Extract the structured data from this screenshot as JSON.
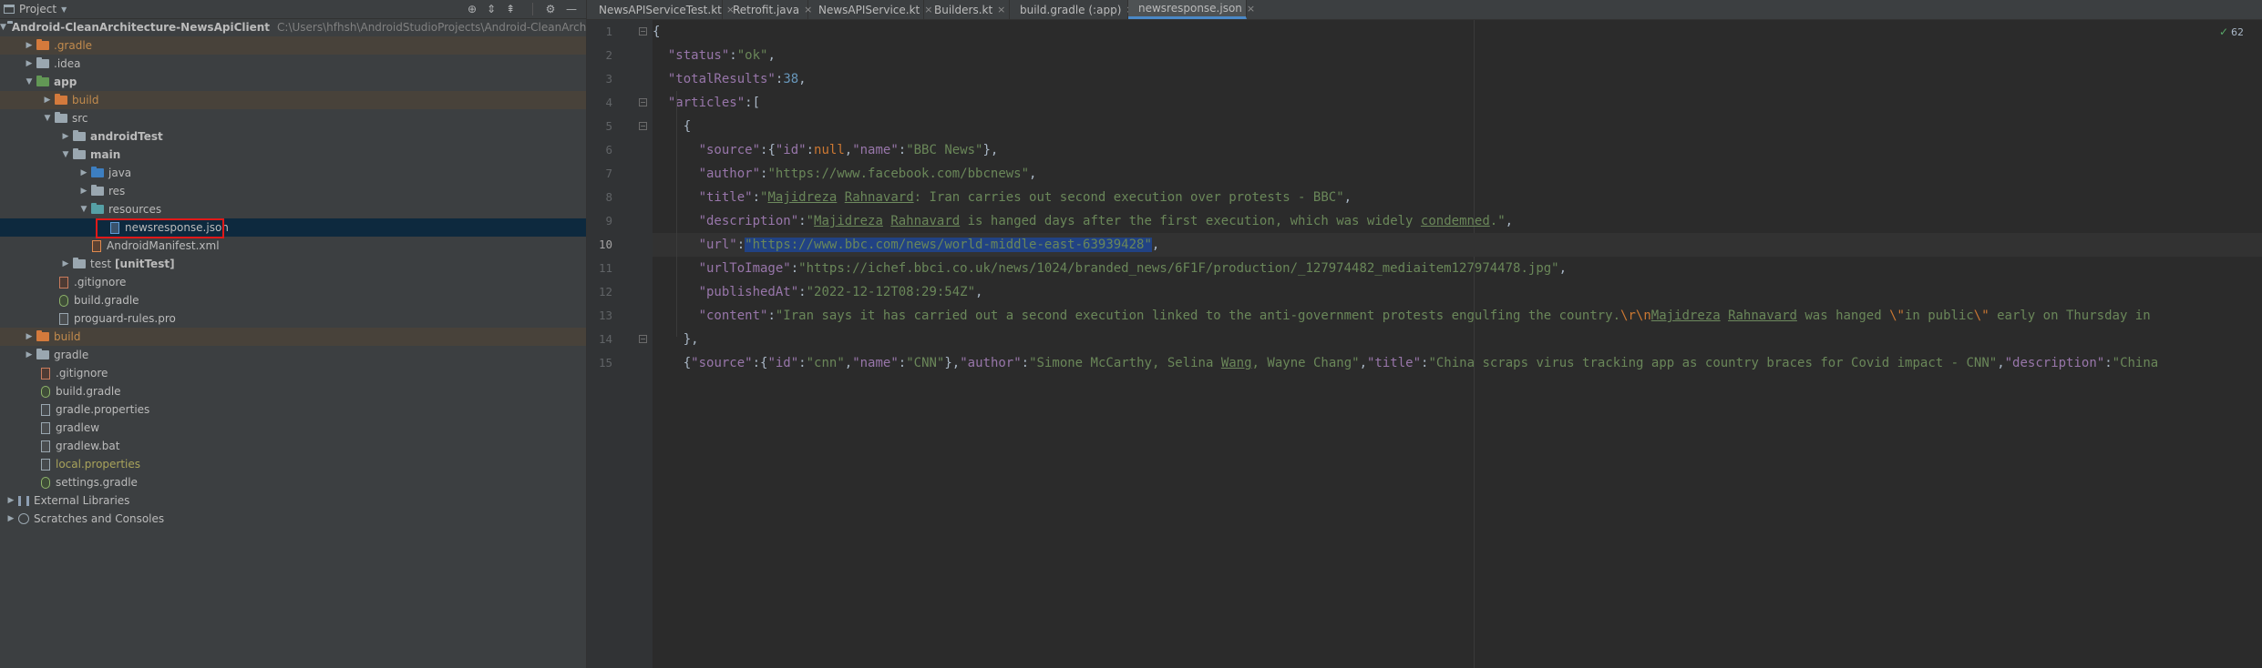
{
  "project_panel": {
    "title": "Project",
    "tools": {
      "locate": "⊕",
      "expand": "⇕",
      "collapse": "⇞",
      "settings": "⚙",
      "hide": "—"
    },
    "tree": [
      {
        "label": "Android-CleanArchitecture-NewsApiClient",
        "path": "C:\\Users\\hfhsh\\AndroidStudioProjects\\Android-CleanArchitec"
      },
      {
        "label": ".gradle"
      },
      {
        "label": ".idea"
      },
      {
        "label": "app"
      },
      {
        "label": "build"
      },
      {
        "label": "src"
      },
      {
        "label": "androidTest"
      },
      {
        "label": "main"
      },
      {
        "label": "java"
      },
      {
        "label": "res"
      },
      {
        "label": "resources"
      },
      {
        "label": "newsresponse.json"
      },
      {
        "label": "AndroidManifest.xml"
      },
      {
        "label": "test",
        "suffix": "[unitTest]"
      },
      {
        "label": ".gitignore"
      },
      {
        "label": "build.gradle"
      },
      {
        "label": "proguard-rules.pro"
      },
      {
        "label": "build"
      },
      {
        "label": "gradle"
      },
      {
        "label": ".gitignore"
      },
      {
        "label": "build.gradle"
      },
      {
        "label": "gradle.properties"
      },
      {
        "label": "gradlew"
      },
      {
        "label": "gradlew.bat"
      },
      {
        "label": "local.properties"
      },
      {
        "label": "settings.gradle"
      },
      {
        "label": "External Libraries"
      },
      {
        "label": "Scratches and Consoles"
      }
    ]
  },
  "tabs": [
    {
      "label": "NewsAPIServiceTest.kt"
    },
    {
      "label": "Retrofit.java"
    },
    {
      "label": "NewsAPIService.kt"
    },
    {
      "label": "Builders.kt"
    },
    {
      "label": "build.gradle (:app)"
    },
    {
      "label": "newsresponse.json"
    }
  ],
  "tab_close_glyph": "×",
  "inspection": {
    "icon": "check-icon",
    "count": "62"
  },
  "code": {
    "line_numbers": [
      "1",
      "2",
      "3",
      "4",
      "5",
      "6",
      "7",
      "8",
      "9",
      "10",
      "11",
      "12",
      "13",
      "14",
      "15"
    ],
    "l1": "{",
    "l2_key": "\"status\"",
    "l2_val": "\"ok\"",
    "l3_key": "\"totalResults\"",
    "l3_val": "38",
    "l4_key": "\"articles\"",
    "l5": "{",
    "l6_key": "\"source\"",
    "l6_k1": "\"id\"",
    "l6_v1": "null",
    "l6_k2": "\"name\"",
    "l6_v2": "\"BBC News\"",
    "l7_key": "\"author\"",
    "l7_val": "\"https://www.facebook.com/bbcnews\"",
    "l8_key": "\"title\"",
    "l8_v_a": "\"",
    "l8_v_b": "Majidreza",
    "l8_v_c": " ",
    "l8_v_d": "Rahnavard",
    "l8_v_e": ": Iran carries out second execution over protests - BBC\"",
    "l9_key": "\"description\"",
    "l9_v_a": "\"",
    "l9_v_b": "Majidreza",
    "l9_v_c": " ",
    "l9_v_d": "Rahnavard",
    "l9_v_e": " is hanged days after the first execution, which was widely ",
    "l9_v_f": "condemned",
    "l9_v_g": ".\"",
    "l10_key": "\"url\"",
    "l10_val": "\"https://www.bbc.com/news/world-middle-east-63939428\"",
    "l11_key": "\"urlToImage\"",
    "l11_val": "\"https://ichef.bbci.co.uk/news/1024/branded_news/6F1F/production/_127974482_mediaitem127974478.jpg\"",
    "l12_key": "\"publishedAt\"",
    "l12_val": "\"2022-12-12T08:29:54Z\"",
    "l13_key": "\"content\"",
    "l13_v_a": "\"Iran says it has carried out a second execution linked to the anti-government protests engulfing the country.",
    "l13_esc1": "\\r\\n",
    "l13_v_b": "Majidreza",
    "l13_v_c": " ",
    "l13_v_d": "Rahnavard",
    "l13_v_e": " was hanged ",
    "l13_esc2": "\\\"",
    "l13_v_f": "in public",
    "l13_esc3": "\\\"",
    "l13_v_g": " early on Thursday in",
    "l14": "},",
    "l15_k1": "\"source\"",
    "l15_k2": "\"id\"",
    "l15_v2": "\"cnn\"",
    "l15_k3": "\"name\"",
    "l15_v3": "\"CNN\"",
    "l15_k4": "\"author\"",
    "l15_v4_a": "\"Simone McCarthy, Selina ",
    "l15_v4_b": "Wang",
    "l15_v4_c": ", Wayne Chang\"",
    "l15_k5": "\"title\"",
    "l15_v5": "\"China scraps virus tracking app as country braces for Covid impact - CNN\"",
    "l15_k6": "\"description\"",
    "l15_v6": "\"China"
  }
}
